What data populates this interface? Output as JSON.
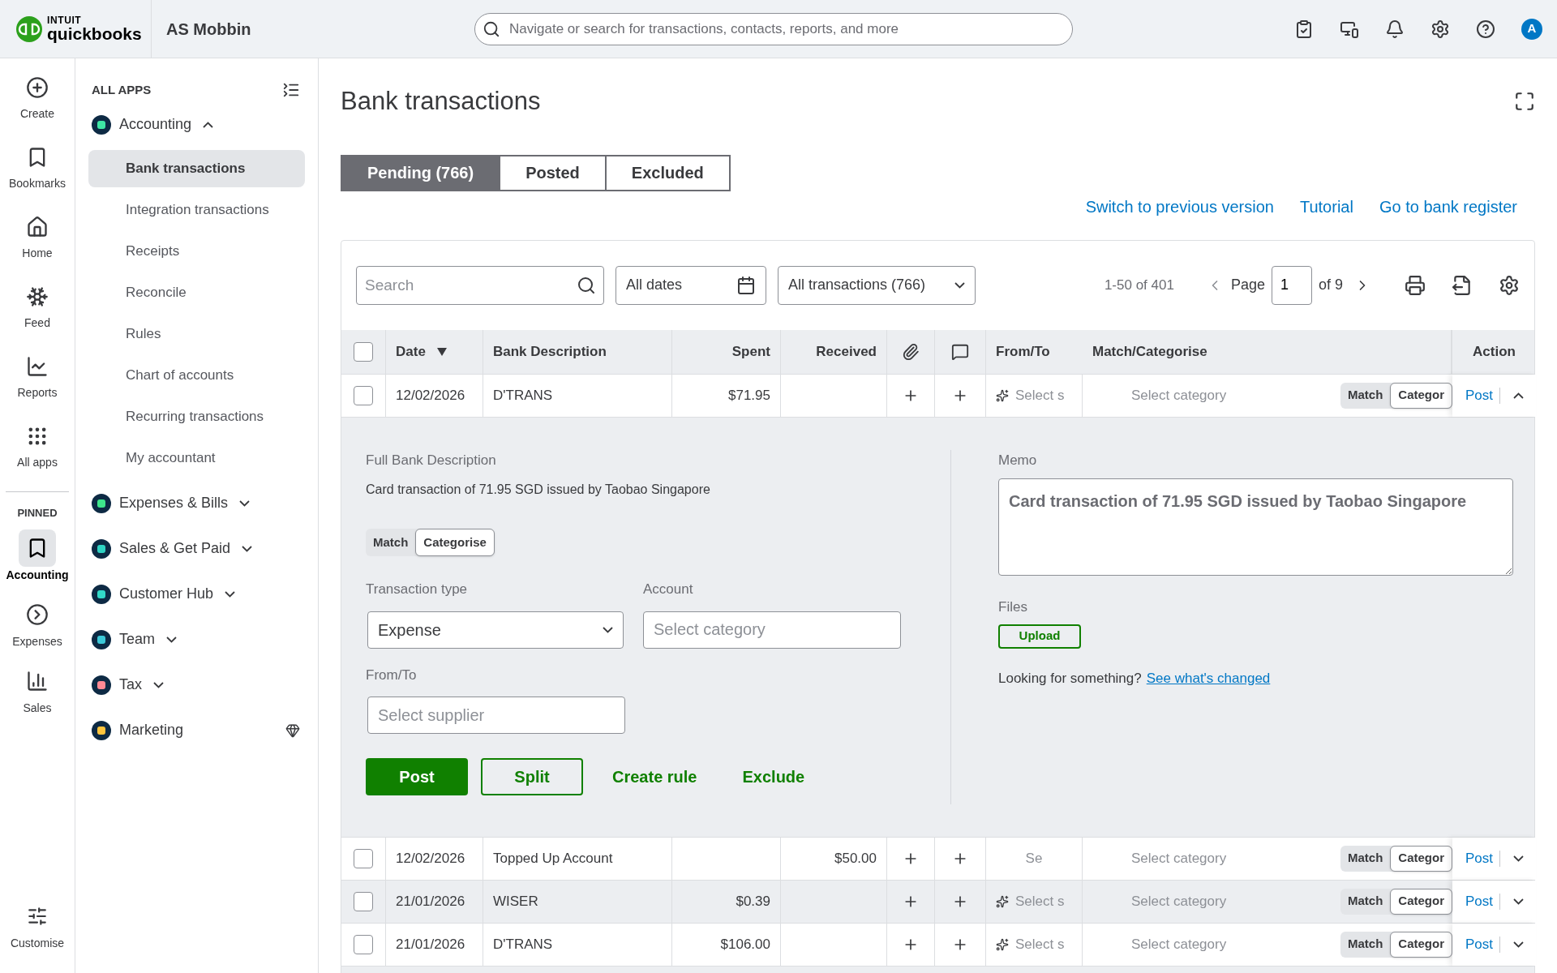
{
  "header": {
    "logo_top": "INTUIT",
    "logo_bottom": "quickbooks",
    "company": "AS Mobbin",
    "search_placeholder": "Navigate or search for transactions, contacts, reports, and more",
    "avatar": "A"
  },
  "rail": {
    "items": [
      {
        "label": "Create"
      },
      {
        "label": "Bookmarks"
      },
      {
        "label": "Home"
      },
      {
        "label": "Feed"
      },
      {
        "label": "Reports"
      },
      {
        "label": "All apps"
      }
    ],
    "pinned_label": "PINNED",
    "pinned": [
      {
        "label": "Accounting",
        "selected": true
      },
      {
        "label": "Expenses",
        "selected": false
      },
      {
        "label": "Sales",
        "selected": false
      }
    ],
    "customise": "Customise"
  },
  "apps": {
    "heading": "ALL APPS",
    "groups": [
      {
        "label": "Accounting",
        "color": "#3ee6a5",
        "kind": "expandable",
        "expanded": true,
        "children": [
          {
            "label": "Bank transactions",
            "selected": true
          },
          {
            "label": "Integration transactions",
            "selected": false
          },
          {
            "label": "Receipts",
            "selected": false
          },
          {
            "label": "Reconcile",
            "selected": false
          },
          {
            "label": "Rules",
            "selected": false
          },
          {
            "label": "Chart of accounts",
            "selected": false
          },
          {
            "label": "Recurring transactions",
            "selected": false
          },
          {
            "label": "My accountant",
            "selected": false
          }
        ]
      },
      {
        "label": "Expenses & Bills",
        "color": "#3ee68c",
        "kind": "expandable",
        "expanded": false
      },
      {
        "label": "Sales & Get Paid",
        "color": "#2fd3c3",
        "kind": "expandable",
        "expanded": false
      },
      {
        "label": "Customer Hub",
        "color": "#32d9c8",
        "kind": "expandable",
        "expanded": false
      },
      {
        "label": "Team",
        "color": "#3cc9d8",
        "kind": "expandable",
        "expanded": false
      },
      {
        "label": "Tax",
        "color": "#ff8a95",
        "kind": "expandable",
        "expanded": false
      },
      {
        "label": "Marketing",
        "color": "#ffc53d",
        "kind": "premium"
      }
    ]
  },
  "page": {
    "title": "Bank transactions",
    "tabs": [
      {
        "label": "Pending (766)",
        "selected": true
      },
      {
        "label": "Posted",
        "selected": false
      },
      {
        "label": "Excluded",
        "selected": false
      }
    ],
    "links": [
      "Switch to previous version",
      "Tutorial",
      "Go to bank register"
    ],
    "toolbar": {
      "search_placeholder": "Search",
      "date_filter": "All dates",
      "type_filter": "All transactions (766)",
      "range": "1-50 of 401",
      "page_label": "Page",
      "page_value": "1",
      "page_total": "of 9"
    },
    "select_all_checked": false,
    "columns": [
      {
        "kind": "checkbox"
      },
      {
        "kind": "text",
        "label": "Date",
        "sort": true
      },
      {
        "kind": "text",
        "label": "Bank Description"
      },
      {
        "kind": "text",
        "label": "Spent"
      },
      {
        "kind": "text",
        "label": "Received"
      },
      {
        "kind": "icon"
      },
      {
        "kind": "icon"
      },
      {
        "kind": "text",
        "label": "From/To"
      },
      {
        "kind": "text",
        "label": "Match/Categorise"
      },
      {
        "kind": "text",
        "label": "Action"
      }
    ],
    "rows": [
      {
        "checked": false,
        "date": "12/02/2026",
        "description": "D'TRANS",
        "spent": "$71.95",
        "received": "",
        "from_to": "Select s",
        "suggested": true,
        "category": "Select category",
        "toggle": [
          {
            "label": "Match",
            "selected": false
          },
          {
            "label": "Categor",
            "selected": true
          }
        ],
        "action": "Post",
        "expanded": true,
        "highlighted": false
      },
      {
        "checked": false,
        "date": "12/02/2026",
        "description": "Topped Up Account",
        "spent": "",
        "received": "$50.00",
        "from_to": "Se",
        "suggested": false,
        "category": "Select category",
        "toggle": [
          {
            "label": "Match",
            "selected": false
          },
          {
            "label": "Categor",
            "selected": true
          }
        ],
        "action": "Post",
        "expanded": false,
        "highlighted": false
      },
      {
        "checked": false,
        "date": "21/01/2026",
        "description": "WISER",
        "spent": "$0.39",
        "received": "",
        "from_to": "Select s",
        "suggested": true,
        "category": "Select category",
        "toggle": [
          {
            "label": "Match",
            "selected": false
          },
          {
            "label": "Categor",
            "selected": true
          }
        ],
        "action": "Post",
        "expanded": false,
        "highlighted": true
      },
      {
        "checked": false,
        "date": "21/01/2026",
        "description": "D'TRANS",
        "spent": "$106.00",
        "received": "",
        "from_to": "Select s",
        "suggested": true,
        "category": "Select category",
        "toggle": [
          {
            "label": "Match",
            "selected": false
          },
          {
            "label": "Categor",
            "selected": true
          }
        ],
        "action": "Post",
        "expanded": false,
        "highlighted": false
      }
    ],
    "detail": {
      "full_desc_label": "Full Bank Description",
      "full_desc": "Card transaction of 71.95 SGD issued by Taobao Singapore",
      "toggle": [
        {
          "label": "Match",
          "selected": false
        },
        {
          "label": "Categorise",
          "selected": true
        }
      ],
      "type_label": "Transaction type",
      "type_value": "Expense",
      "account_label": "Account",
      "account_placeholder": "Select category",
      "from_to_label": "From/To",
      "from_to_placeholder": "Select supplier",
      "post": "Post",
      "split": "Split",
      "create_rule": "Create rule",
      "exclude": "Exclude",
      "memo_label": "Memo",
      "memo": "Card transaction of 71.95 SGD issued by Taobao Singapore",
      "files_label": "Files",
      "upload": "Upload",
      "looking": "Looking for something?",
      "changed_link": "See what's changed"
    }
  }
}
